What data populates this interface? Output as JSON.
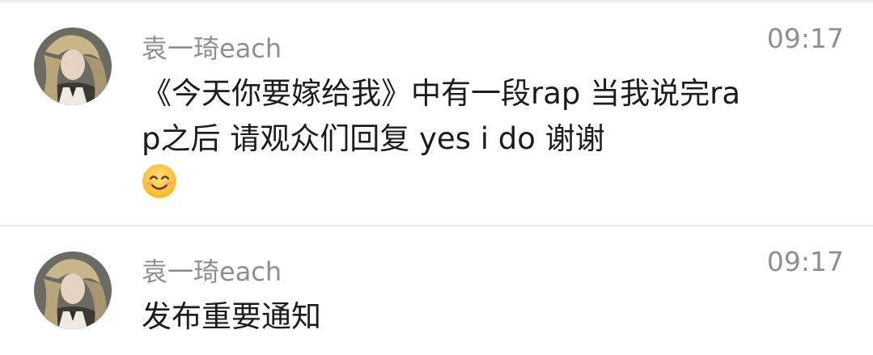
{
  "messages": [
    {
      "sender": "袁一琦each",
      "time": "09:17",
      "text": "《今天你要嫁给我》中有一段rap 当我说完rap之后 请观众们回复 yes  i do 谢谢",
      "emoji": "smiling-face-with-smiling-eyes",
      "avatar_icon": "user-avatar-photo"
    },
    {
      "sender": "袁一琦each",
      "time": "09:17",
      "text": "发布重要通知",
      "avatar_icon": "user-avatar-photo"
    }
  ]
}
